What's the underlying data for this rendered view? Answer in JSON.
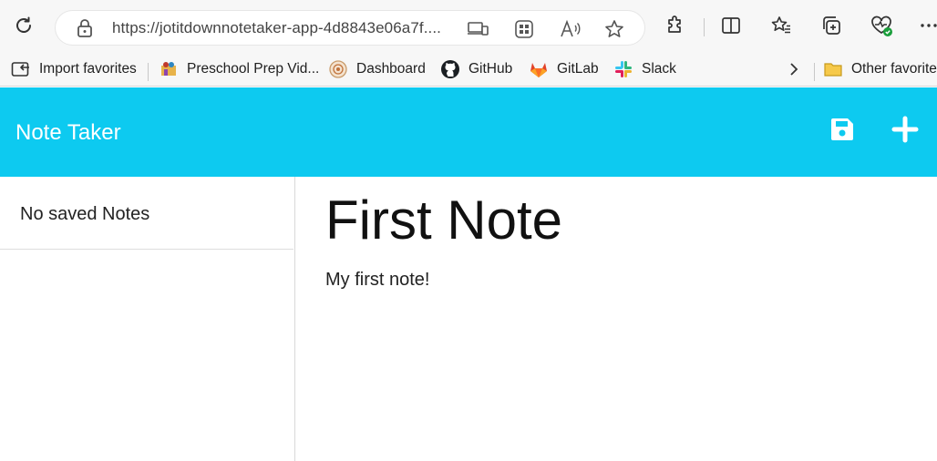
{
  "browser": {
    "url": "https://jotitdownnotetaker-app-4d8843e06a7f....",
    "icons": {
      "refresh": "refresh-icon",
      "lock": "lock-icon",
      "device": "device-icon",
      "apps": "apps-icon",
      "read_aloud": "read-aloud-icon",
      "favorite": "star-icon",
      "extensions": "puzzle-icon",
      "split": "split-screen-icon",
      "favorites": "favorites-icon",
      "collections": "collections-icon",
      "health": "browser-essentials-icon",
      "more": "more-icon"
    }
  },
  "bookmarks": {
    "items": [
      {
        "label": "Import favorites",
        "icon": "import-icon"
      },
      {
        "label": "Preschool Prep Vid...",
        "icon": "preschool-icon"
      },
      {
        "label": "Dashboard",
        "icon": "dashboard-icon"
      },
      {
        "label": "GitHub",
        "icon": "github-icon"
      },
      {
        "label": "GitLab",
        "icon": "gitlab-icon"
      },
      {
        "label": "Slack",
        "icon": "slack-icon"
      }
    ],
    "other_label": "Other favorites"
  },
  "app": {
    "title": "Note Taker",
    "accent": "#0dcaf0",
    "save_icon": "save-icon",
    "add_icon": "plus-icon"
  },
  "sidebar": {
    "empty_label": "No saved Notes"
  },
  "note": {
    "title": "First Note",
    "body": "My first note!"
  }
}
